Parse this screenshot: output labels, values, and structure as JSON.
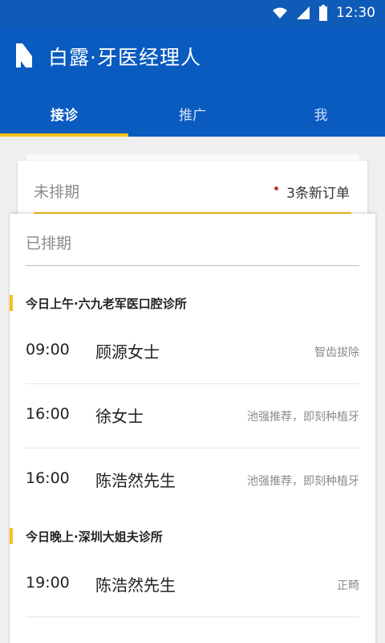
{
  "status_bar": {
    "time": "12:30",
    "icons": [
      "wifi-icon",
      "signal-icon",
      "battery-icon"
    ]
  },
  "app": {
    "title": "白露·牙医经理人",
    "brand_color": "#0a5bc0",
    "accent_color": "#f6c21b"
  },
  "tabs": [
    {
      "label": "接诊",
      "active": true
    },
    {
      "label": "推广",
      "active": false
    },
    {
      "label": "我",
      "active": false
    }
  ],
  "unscheduled": {
    "label": "未排期",
    "new_orders": "3条新订单"
  },
  "scheduled": {
    "label": "已排期",
    "sections": [
      {
        "title": "今日上午·六九老军医口腔诊所",
        "appointments": [
          {
            "time": "09:00",
            "name": "顾源女士",
            "note": "智齿拔除"
          },
          {
            "time": "16:00",
            "name": "徐女士",
            "note": "池强推荐，即刻种植牙"
          },
          {
            "time": "16:00",
            "name": "陈浩然先生",
            "note": "池强推荐，即刻种植牙"
          }
        ]
      },
      {
        "title": "今日晚上·深圳大姐夫诊所",
        "appointments": [
          {
            "time": "19:00",
            "name": "陈浩然先生",
            "note": "正畸"
          }
        ]
      }
    ]
  }
}
